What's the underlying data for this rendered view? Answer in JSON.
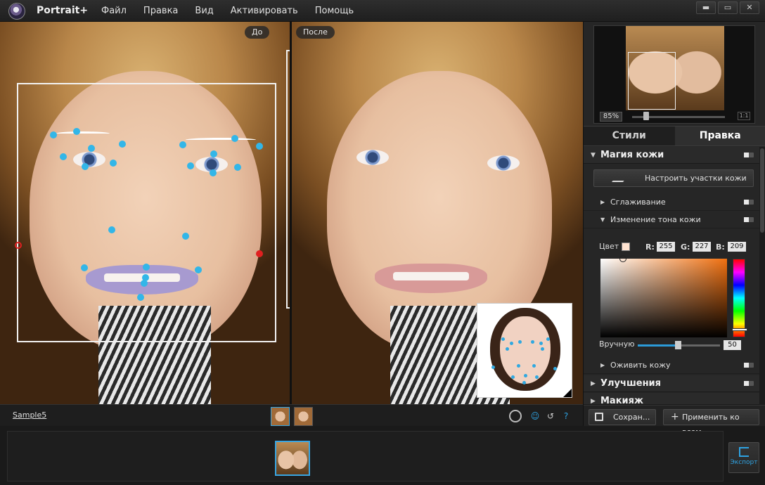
{
  "app": {
    "title": "Portrait+"
  },
  "menu": [
    "Файл",
    "Правка",
    "Вид",
    "Активировать",
    "Помощь"
  ],
  "window_controls": {
    "minimize": "▬",
    "maximize": "▭",
    "close": "✕"
  },
  "canvas": {
    "before_label": "До",
    "after_label": "После"
  },
  "navigator": {
    "zoom": "85%",
    "one_to_one": "1:1"
  },
  "tabs": {
    "styles": "Стили",
    "edit": "Правка"
  },
  "panel": {
    "skin_magic": "Магия кожи",
    "adjust_skin_button": "Настроить участки кожи",
    "smoothing": "Сглаживание",
    "tone_change": "Изменение тона кожи",
    "color_label": "Цвет",
    "r_label": "R:",
    "r_value": "255",
    "g_label": "G:",
    "g_value": "227",
    "b_label": "B:",
    "b_value": "209",
    "swatch_color": "#ffe3d1",
    "manual_label": "Вручную",
    "manual_value": "50",
    "revive_skin": "Оживить кожу",
    "improvements": "Улучшения",
    "makeup": "Макияж"
  },
  "footer": {
    "save_button": "Сохран...",
    "apply_all_button": "Применить ко всем"
  },
  "status": {
    "filename": "Sample5",
    "help": "?"
  },
  "export": {
    "label": "Экспорт"
  },
  "colors": {
    "accent": "#2ea3e3",
    "feature_point": "#32b6e8",
    "boundary_point": "#e02020"
  }
}
